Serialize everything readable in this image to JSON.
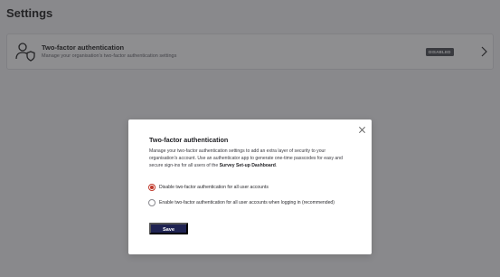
{
  "page": {
    "title": "Settings"
  },
  "card": {
    "title": "Two-factor authentication",
    "subtitle": "Manage your organisation's two-factor authentication settings",
    "status_badge": "DISABLED",
    "icon": "user-shield-icon",
    "chevron_icon": "chevron-right-icon"
  },
  "modal": {
    "title": "Two-factor authentication",
    "description_prefix": "Manage your two-factor authentication settings to add an extra layer of security to your organisation's account. Use an authenticator app to generate one-time passcodes for easy and secure sign-ins for all users of the ",
    "description_strong": "Survey Set-up Dashboard",
    "description_suffix": ".",
    "options": [
      {
        "label": "Disable two-factor authentication for all user accounts",
        "selected": true
      },
      {
        "label": "Enable two-factor authentication for all user accounts when logging in (recommended)",
        "selected": false
      }
    ],
    "save_label": "Save",
    "close_icon": "close-icon"
  },
  "colors": {
    "accent_radio": "#c0392b",
    "primary_button": "#1f2352",
    "badge_bg": "#55575d"
  }
}
